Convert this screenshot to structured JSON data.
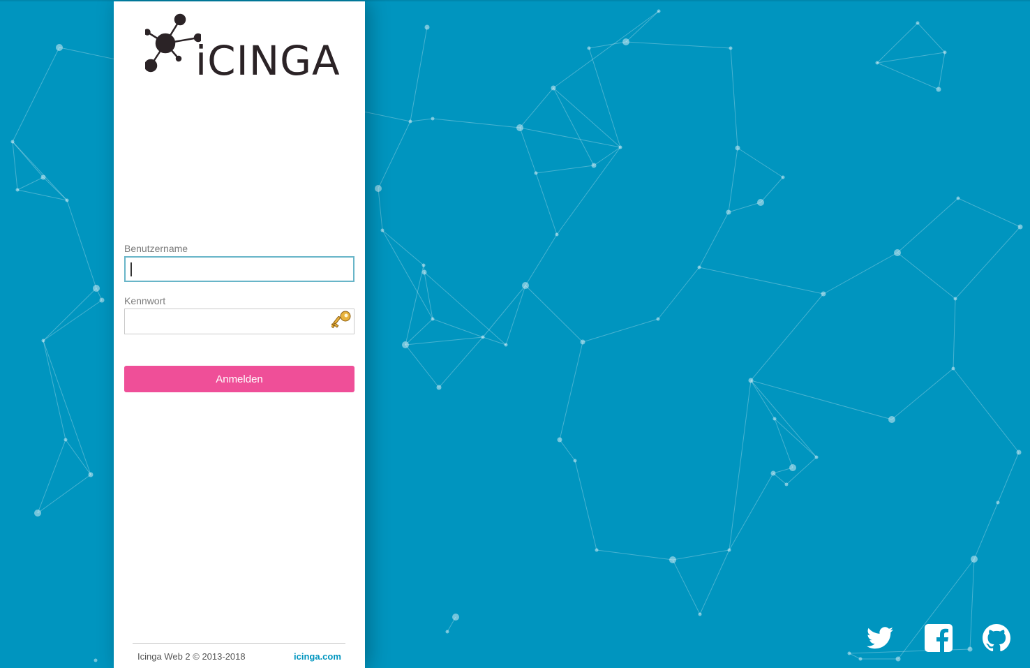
{
  "app": {
    "logo_text": "iCINGA"
  },
  "login_form": {
    "username_label": "Benutzername",
    "username_value": "",
    "password_label": "Kennwort",
    "password_value": "",
    "submit_label": "Anmelden"
  },
  "footer": {
    "copyright": "Icinga Web 2 © 2013-2018",
    "link_text": "icinga.com"
  },
  "social": [
    {
      "name": "twitter",
      "icon": "twitter-icon"
    },
    {
      "name": "facebook",
      "icon": "facebook-icon"
    },
    {
      "name": "github",
      "icon": "github-icon"
    }
  ],
  "colors": {
    "background": "#0095bf",
    "panel": "#ffffff",
    "submit_button": "#ef4f98",
    "link": "#0095bf",
    "logo": "#2b2326"
  }
}
